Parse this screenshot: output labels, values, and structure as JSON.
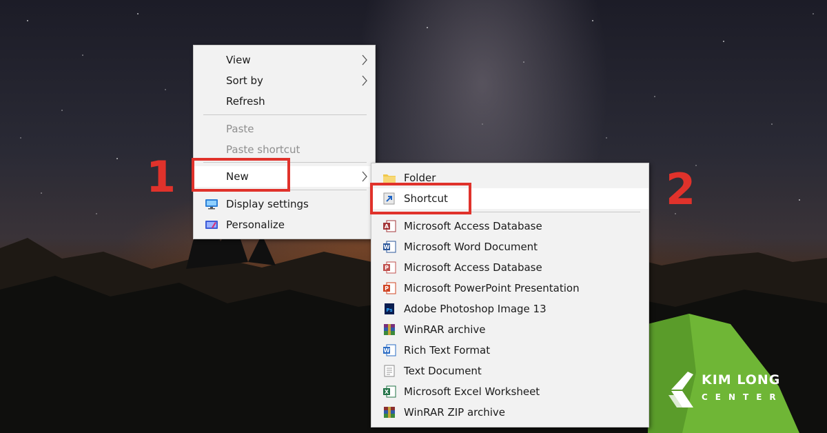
{
  "main_menu": {
    "items": [
      {
        "label": "View",
        "submenu": true,
        "enabled": true
      },
      {
        "label": "Sort by",
        "submenu": true,
        "enabled": true
      },
      {
        "label": "Refresh",
        "submenu": false,
        "enabled": true
      },
      {
        "label": "Paste",
        "submenu": false,
        "enabled": false
      },
      {
        "label": "Paste shortcut",
        "submenu": false,
        "enabled": false
      },
      {
        "label": "New",
        "submenu": true,
        "enabled": true,
        "highlighted": true
      },
      {
        "label": "Display settings",
        "submenu": false,
        "enabled": true,
        "icon": "display-icon"
      },
      {
        "label": "Personalize",
        "submenu": false,
        "enabled": true,
        "icon": "personalize-icon"
      }
    ]
  },
  "new_submenu": {
    "items": [
      {
        "label": "Folder",
        "icon": "folder-icon"
      },
      {
        "label": "Shortcut",
        "icon": "shortcut-icon",
        "highlighted": true
      },
      {
        "label": "Microsoft Access Database",
        "icon": "access-icon"
      },
      {
        "label": "Microsoft Word Document",
        "icon": "word-icon"
      },
      {
        "label": "Microsoft Access Database",
        "icon": "access-icon"
      },
      {
        "label": "Microsoft PowerPoint Presentation",
        "icon": "powerpoint-icon"
      },
      {
        "label": "Adobe Photoshop Image 13",
        "icon": "photoshop-icon"
      },
      {
        "label": "WinRAR archive",
        "icon": "winrar-icon"
      },
      {
        "label": "Rich Text Format",
        "icon": "wordpad-icon"
      },
      {
        "label": "Text Document",
        "icon": "text-document-icon"
      },
      {
        "label": "Microsoft Excel Worksheet",
        "icon": "excel-icon"
      },
      {
        "label": "WinRAR ZIP archive",
        "icon": "winrar-zip-icon"
      }
    ]
  },
  "annotations": {
    "step1": "1",
    "step2": "2",
    "color": "#e0322b"
  },
  "logo": {
    "line1": "KIM LONG",
    "line2": "CENTER"
  },
  "colors": {
    "menu_bg": "#f2f2f2",
    "hover_bg": "#ffffff",
    "disabled_text": "#8f8f8f",
    "tent_green": "#7cc63a"
  }
}
